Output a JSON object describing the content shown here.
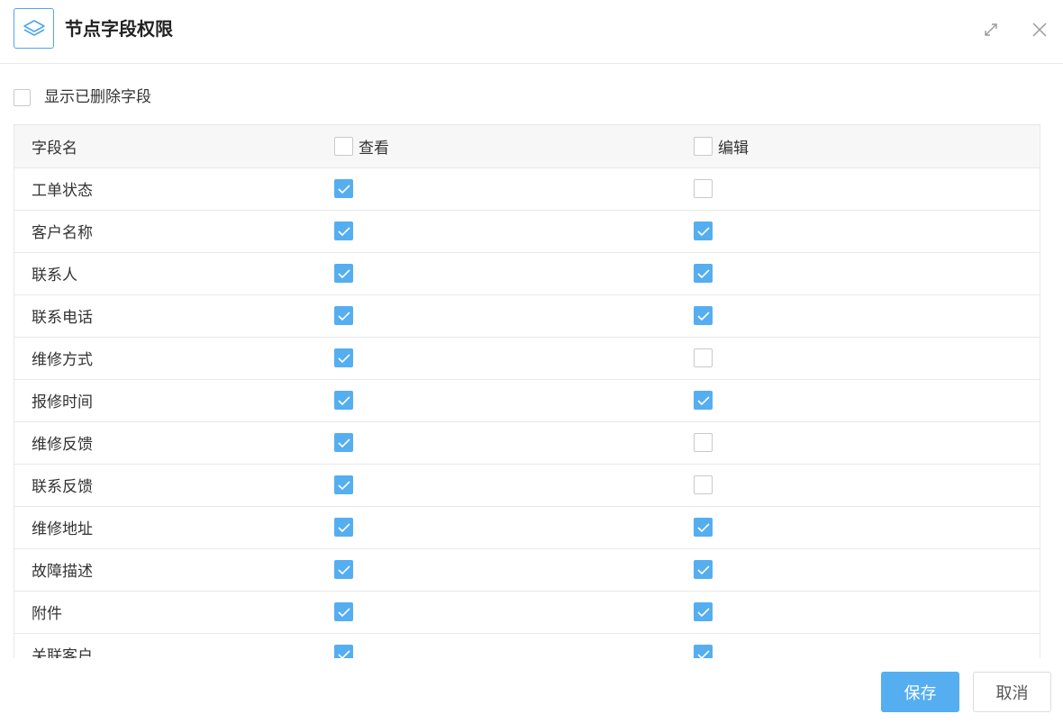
{
  "dialog": {
    "title": "节点字段权限",
    "icon": "layers-icon"
  },
  "options": {
    "show_deleted_label": "显示已删除字段",
    "show_deleted_checked": false
  },
  "table": {
    "columns": {
      "name": "字段名",
      "view": "查看",
      "edit": "编辑"
    },
    "header_view_checked": false,
    "header_edit_checked": false,
    "rows": [
      {
        "name": "工单状态",
        "view": true,
        "edit": false
      },
      {
        "name": "客户名称",
        "view": true,
        "edit": true
      },
      {
        "name": "联系人",
        "view": true,
        "edit": true
      },
      {
        "name": "联系电话",
        "view": true,
        "edit": true
      },
      {
        "name": "维修方式",
        "view": true,
        "edit": false
      },
      {
        "name": "报修时间",
        "view": true,
        "edit": true
      },
      {
        "name": "维修反馈",
        "view": true,
        "edit": false
      },
      {
        "name": "联系反馈",
        "view": true,
        "edit": false
      },
      {
        "name": "维修地址",
        "view": true,
        "edit": true
      },
      {
        "name": "故障描述",
        "view": true,
        "edit": true
      },
      {
        "name": "附件",
        "view": true,
        "edit": true
      },
      {
        "name": "关联客户",
        "view": true,
        "edit": true
      }
    ]
  },
  "footer": {
    "save_label": "保存",
    "cancel_label": "取消"
  },
  "colors": {
    "accent": "#55aef0",
    "border": "#e8e8e8"
  }
}
